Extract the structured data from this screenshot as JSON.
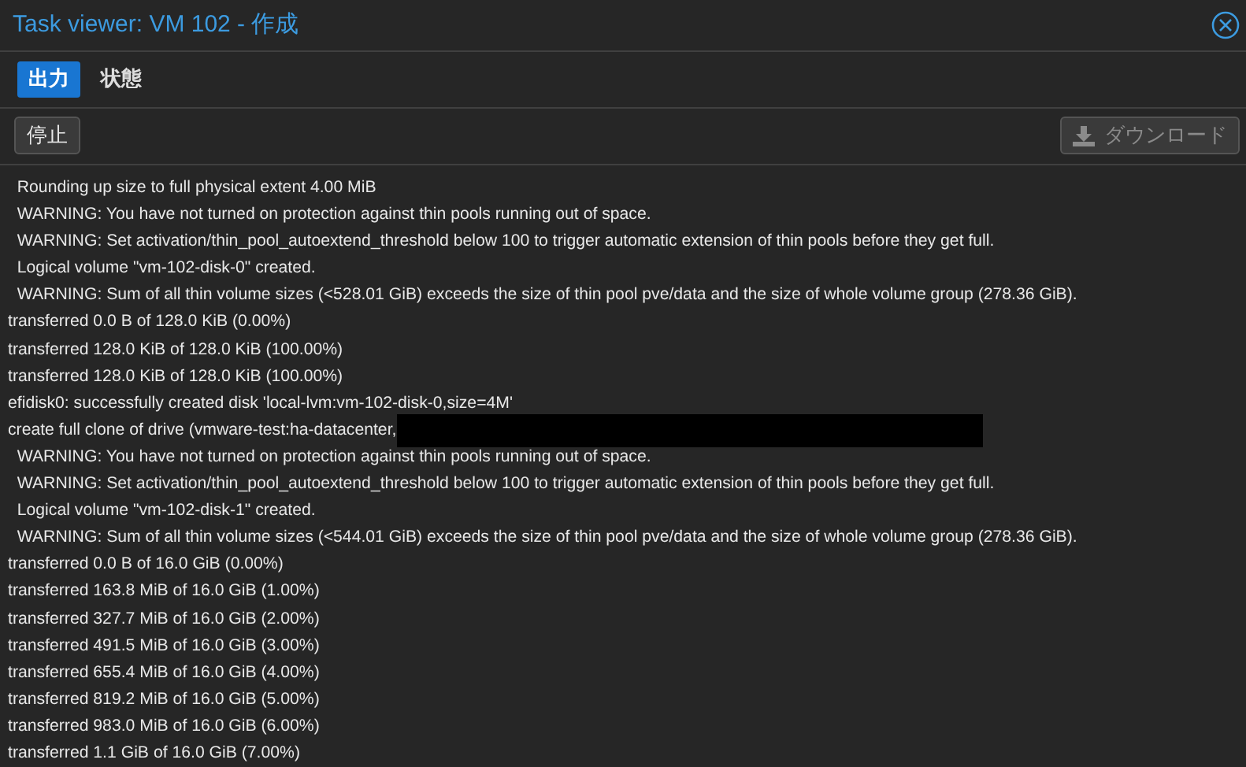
{
  "window": {
    "title": "Task viewer: VM 102 - 作成"
  },
  "tabs": [
    {
      "label": "出力",
      "selected": true
    },
    {
      "label": "状態",
      "selected": false
    }
  ],
  "toolbar": {
    "stop": {
      "label": "停止",
      "disabled": false
    },
    "download": {
      "label": "ダウンロード",
      "disabled": true
    }
  },
  "log": [
    {
      "text": "  Rounding up size to full physical extent 4.00 MiB"
    },
    {
      "text": "  WARNING: You have not turned on protection against thin pools running out of space."
    },
    {
      "text": "  WARNING: Set activation/thin_pool_autoextend_threshold below 100 to trigger automatic extension of thin pools before they get full."
    },
    {
      "text": "  Logical volume \"vm-102-disk-0\" created."
    },
    {
      "text": "  WARNING: Sum of all thin volume sizes (<528.01 GiB) exceeds the size of thin pool pve/data and the size of whole volume group (278.36 GiB)."
    },
    {
      "text": "transferred 0.0 B of 128.0 KiB (0.00%)"
    },
    {
      "text": "transferred 128.0 KiB of 128.0 KiB (100.00%)"
    },
    {
      "text": "transferred 128.0 KiB of 128.0 KiB (100.00%)"
    },
    {
      "text": "efidisk0: successfully created disk 'local-lvm:vm-102-disk-0,size=4M'"
    },
    {
      "text": "create full clone of drive (vmware-test:ha-datacenter,",
      "redacted": true
    },
    {
      "text": "  WARNING: You have not turned on protection against thin pools running out of space."
    },
    {
      "text": "  WARNING: Set activation/thin_pool_autoextend_threshold below 100 to trigger automatic extension of thin pools before they get full."
    },
    {
      "text": "  Logical volume \"vm-102-disk-1\" created."
    },
    {
      "text": "  WARNING: Sum of all thin volume sizes (<544.01 GiB) exceeds the size of thin pool pve/data and the size of whole volume group (278.36 GiB)."
    },
    {
      "text": "transferred 0.0 B of 16.0 GiB (0.00%)"
    },
    {
      "text": "transferred 163.8 MiB of 16.0 GiB (1.00%)"
    },
    {
      "text": "transferred 327.7 MiB of 16.0 GiB (2.00%)"
    },
    {
      "text": "transferred 491.5 MiB of 16.0 GiB (3.00%)"
    },
    {
      "text": "transferred 655.4 MiB of 16.0 GiB (4.00%)"
    },
    {
      "text": "transferred 819.2 MiB of 16.0 GiB (5.00%)"
    },
    {
      "text": "transferred 983.0 MiB of 16.0 GiB (6.00%)"
    },
    {
      "text": "transferred 1.1 GiB of 16.0 GiB (7.00%)"
    }
  ]
}
